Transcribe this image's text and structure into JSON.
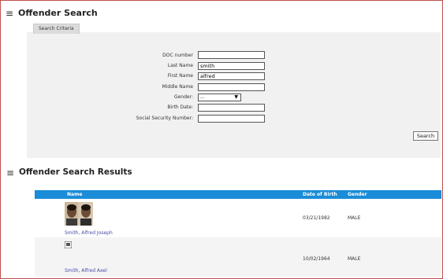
{
  "search_section": {
    "title": "Offender Search",
    "tab_label": "Search Criteria"
  },
  "form": {
    "doc_number": {
      "label": "DOC number",
      "value": ""
    },
    "last_name": {
      "label": "Last Name",
      "value": "smith"
    },
    "first_name": {
      "label": "First Name",
      "value": "alfred"
    },
    "middle_name": {
      "label": "Middle Name",
      "value": ""
    },
    "gender": {
      "label": "Gender:",
      "value": "..."
    },
    "birth_date": {
      "label": "Birth Date:",
      "value": ""
    },
    "ssn": {
      "label": "Social Security Number:",
      "value": ""
    },
    "search_label": "Search"
  },
  "results_section": {
    "title": "Offender Search Results",
    "columns": {
      "name": "Name",
      "dob": "Date of Birth",
      "gender": "Gender"
    },
    "rows": [
      {
        "name": "Smith, Alfred Joseph",
        "dob": "03/21/1982",
        "gender": "MALE"
      },
      {
        "name": "Smith, Alfred Axel",
        "dob": "10/02/1964",
        "gender": "MALE"
      }
    ]
  },
  "colors": {
    "header_blue": "#1a8cd8",
    "frame_border": "#c0504d",
    "link": "#4a4aa8"
  }
}
